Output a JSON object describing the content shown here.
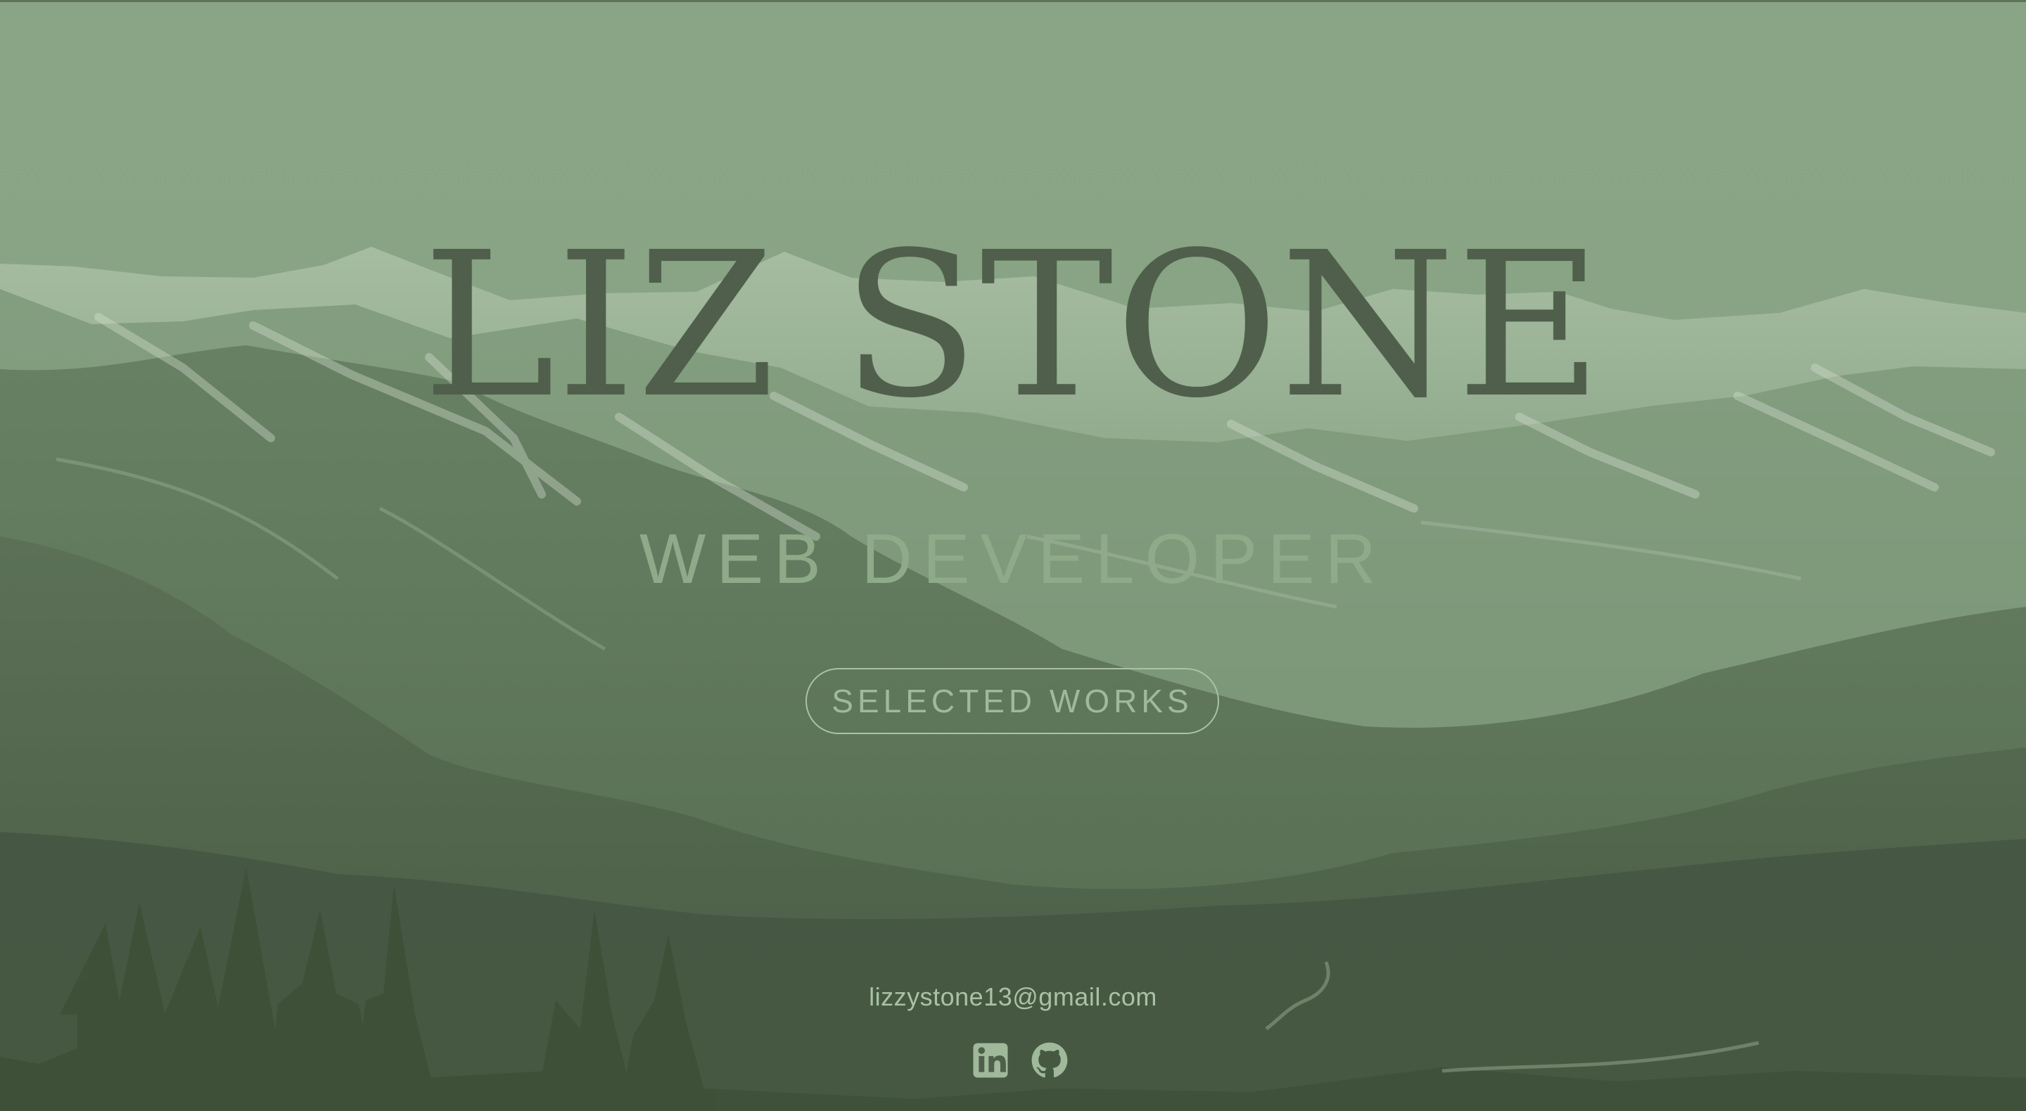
{
  "hero": {
    "name": "LIZ STONE",
    "role": "WEB DEVELOPER",
    "cta_label": "SELECTED WORKS",
    "email": "lizzystone13@gmail.com"
  },
  "social": {
    "linkedin_icon": "linkedin-icon",
    "github_icon": "github-icon"
  },
  "colors": {
    "background": "#8aa586",
    "title": "#4f5f4b",
    "accent": "#9fb99a"
  }
}
